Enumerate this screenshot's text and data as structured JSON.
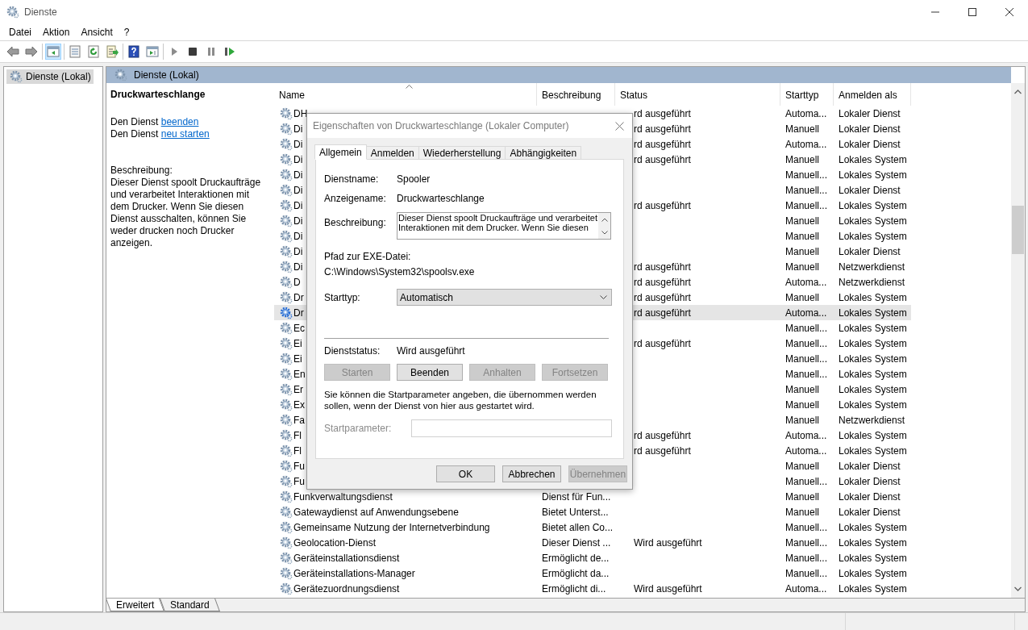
{
  "window": {
    "title": "Dienste"
  },
  "menu": [
    "Datei",
    "Aktion",
    "Ansicht",
    "?"
  ],
  "toolbar": [
    [
      {
        "kind": "back",
        "selected": false
      },
      {
        "kind": "forward",
        "selected": false
      }
    ],
    [
      {
        "kind": "tree",
        "selected": true
      }
    ],
    [
      {
        "kind": "properties",
        "selected": false
      },
      {
        "kind": "refresh",
        "selected": false
      },
      {
        "kind": "export",
        "selected": false
      }
    ],
    [
      {
        "kind": "help",
        "selected": false
      },
      {
        "kind": "pane",
        "selected": false
      }
    ],
    [
      {
        "kind": "start",
        "selected": false
      },
      {
        "kind": "stop",
        "selected": false
      },
      {
        "kind": "pause",
        "selected": false
      },
      {
        "kind": "resume",
        "selected": false
      }
    ]
  ],
  "tree": {
    "items": [
      {
        "label": "Dienste (Lokal)",
        "selected": true
      }
    ]
  },
  "pane_header": "Dienste (Lokal)",
  "details": {
    "title": "Druckwarteschlange",
    "actions": [
      {
        "prefix": "Den Dienst",
        "link": "beenden"
      },
      {
        "prefix": "Den Dienst",
        "link": "neu starten"
      }
    ],
    "description_label": "Beschreibung:",
    "description": "Dieser Dienst spoolt Druckaufträge und verarbeitet Interaktionen mit dem Drucker. Wenn Sie diesen Dienst ausschalten, können Sie weder drucken noch Drucker anzeigen."
  },
  "table": {
    "columns": [
      {
        "label": "Name",
        "sorted": true
      },
      {
        "label": "Beschreibung",
        "sorted": false
      },
      {
        "label": "Status",
        "sorted": false
      },
      {
        "label": "Starttyp",
        "sorted": false
      },
      {
        "label": "Anmelden als",
        "sorted": false
      }
    ],
    "rows": [
      {
        "name": "DH",
        "status": "rd ausgeführt",
        "startup": "Automa...",
        "logon": "Lokaler Dienst",
        "selected": false
      },
      {
        "name": "Di",
        "status": "rd ausgeführt",
        "startup": "Manuell",
        "logon": "Lokaler Dienst",
        "selected": false
      },
      {
        "name": "Di",
        "status": "rd ausgeführt",
        "startup": "Automa...",
        "logon": "Lokaler Dienst",
        "selected": false
      },
      {
        "name": "Di",
        "status": "rd ausgeführt",
        "startup": "Manuell",
        "logon": "Lokales System",
        "selected": false
      },
      {
        "name": "Di",
        "startup": "Manuell...",
        "logon": "Lokales System",
        "selected": false
      },
      {
        "name": "Di",
        "startup": "Manuell...",
        "logon": "Lokaler Dienst",
        "selected": false
      },
      {
        "name": "Di",
        "status": "rd ausgeführt",
        "startup": "Manuell...",
        "logon": "Lokales System",
        "selected": false
      },
      {
        "name": "Di",
        "startup": "Manuell",
        "logon": "Lokales System",
        "selected": false
      },
      {
        "name": "Di",
        "startup": "Manuell",
        "logon": "Lokales System",
        "selected": false
      },
      {
        "name": "Di",
        "startup": "Manuell",
        "logon": "Lokaler Dienst",
        "selected": false
      },
      {
        "name": "Di",
        "status": "rd ausgeführt",
        "startup": "Manuell",
        "logon": "Netzwerkdienst",
        "selected": false
      },
      {
        "name": "D",
        "status": "rd ausgeführt",
        "startup": "Automa...",
        "logon": "Netzwerkdienst",
        "selected": false
      },
      {
        "name": "Dr",
        "status": "rd ausgeführt",
        "startup": "Manuell",
        "logon": "Lokales System",
        "selected": false
      },
      {
        "name": "Dr",
        "status": "rd ausgeführt",
        "startup": "Automa...",
        "logon": "Lokales System",
        "selected": true
      },
      {
        "name": "Ec",
        "startup": "Manuell...",
        "logon": "Lokales System",
        "selected": false
      },
      {
        "name": "Ei",
        "status": "rd ausgeführt",
        "startup": "Manuell...",
        "logon": "Lokales System",
        "selected": false
      },
      {
        "name": "Ei",
        "startup": "Manuell...",
        "logon": "Lokales System",
        "selected": false
      },
      {
        "name": "En",
        "startup": "Manuell...",
        "logon": "Lokales System",
        "selected": false
      },
      {
        "name": "Er",
        "startup": "Manuell",
        "logon": "Lokales System",
        "selected": false
      },
      {
        "name": "Ex",
        "startup": "Manuell",
        "logon": "Lokales System",
        "selected": false
      },
      {
        "name": "Fa",
        "startup": "Manuell",
        "logon": "Netzwerkdienst",
        "selected": false
      },
      {
        "name": "Fl",
        "status": "rd ausgeführt",
        "startup": "Automa...",
        "logon": "Lokales System",
        "selected": false
      },
      {
        "name": "Fl",
        "status": "rd ausgeführt",
        "startup": "Automa...",
        "logon": "Lokales System",
        "selected": false
      },
      {
        "name": "Fu",
        "startup": "Manuell",
        "logon": "Lokaler Dienst",
        "selected": false
      },
      {
        "name": "Fu",
        "startup": "Manuell...",
        "logon": "Lokaler Dienst",
        "selected": false
      },
      {
        "name": "Funkverwaltungsdienst",
        "description": "Dienst für Fun...",
        "startup": "Manuell",
        "logon": "Lokaler Dienst",
        "selected": false
      },
      {
        "name": "Gatewaydienst auf Anwendungsebene",
        "description": "Bietet Unterst...",
        "startup": "Manuell",
        "logon": "Lokaler Dienst",
        "selected": false
      },
      {
        "name": "Gemeinsame Nutzung der Internetverbindung",
        "description": "Bietet allen Co...",
        "startup": "Manuell...",
        "logon": "Lokales System",
        "selected": false
      },
      {
        "name": "Geolocation-Dienst",
        "description": "Dieser Dienst ...",
        "status": "Wird ausgeführt",
        "startup": "Manuell...",
        "logon": "Lokales System",
        "selected": false
      },
      {
        "name": "Geräteinstallationsdienst",
        "description": "Ermöglicht de...",
        "startup": "Manuell...",
        "logon": "Lokales System",
        "selected": false
      },
      {
        "name": "Geräteinstallations-Manager",
        "description": "Ermöglicht da...",
        "startup": "Manuell...",
        "logon": "Lokales System",
        "selected": false
      },
      {
        "name": "Gerätezuordnungsdienst",
        "description": "Ermöglicht di...",
        "status": "Wird ausgeführt",
        "startup": "Automa...",
        "logon": "Lokales System",
        "selected": false
      }
    ]
  },
  "view_tabs": [
    {
      "label": "Erweitert",
      "selected": true
    },
    {
      "label": "Standard",
      "selected": false
    }
  ],
  "dialog": {
    "title": "Eigenschaften von Druckwarteschlange (Lokaler Computer)",
    "tabs": [
      {
        "label": "Allgemein",
        "selected": true
      },
      {
        "label": "Anmelden",
        "selected": false
      },
      {
        "label": "Wiederherstellung",
        "selected": false
      },
      {
        "label": "Abhängigkeiten",
        "selected": false
      }
    ],
    "service_name": {
      "label": "Dienstname:",
      "value": "Spooler"
    },
    "display_name": {
      "label": "Anzeigename:",
      "value": "Druckwarteschlange"
    },
    "description": {
      "label": "Beschreibung:",
      "value": "Dieser Dienst spoolt Druckaufträge und verarbeitet Interaktionen mit dem Drucker. Wenn Sie diesen"
    },
    "exe_path": {
      "label": "Pfad zur EXE-Datei:",
      "value": "C:\\Windows\\System32\\spoolsv.exe"
    },
    "startup_type": {
      "label": "Starttyp:",
      "value": "Automatisch"
    },
    "service_status": {
      "label": "Dienststatus:",
      "value": "Wird ausgeführt"
    },
    "control_buttons": [
      {
        "label": "Starten",
        "disabled": true
      },
      {
        "label": "Beenden",
        "disabled": false
      },
      {
        "label": "Anhalten",
        "disabled": true
      },
      {
        "label": "Fortsetzen",
        "disabled": true
      }
    ],
    "hint": "Sie können die Startparameter angeben, die übernommen werden sollen, wenn der Dienst von hier aus gestartet wird.",
    "start_parameters": {
      "label": "Startparameter:",
      "disabled": true
    },
    "buttons": [
      {
        "label": "OK",
        "disabled": false
      },
      {
        "label": "Abbrechen",
        "disabled": false
      },
      {
        "label": "Übernehmen",
        "disabled": true
      }
    ]
  }
}
